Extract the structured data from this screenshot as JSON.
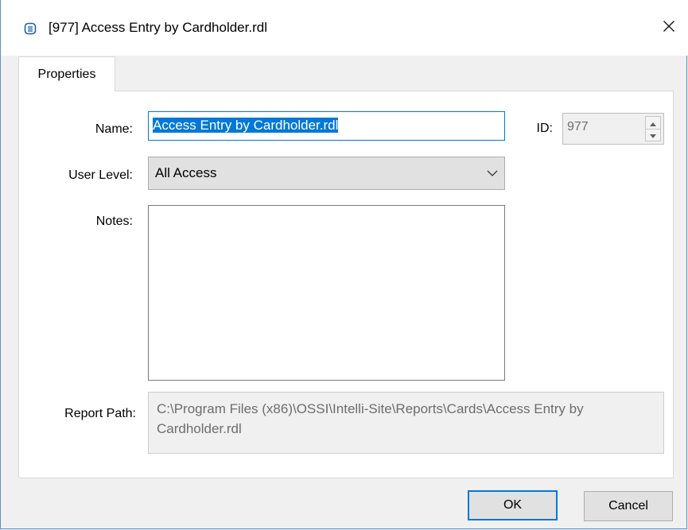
{
  "window": {
    "title": "[977] Access Entry by Cardholder.rdl",
    "close_glyph": "✕"
  },
  "tabs": [
    {
      "label": "Properties"
    }
  ],
  "form": {
    "name_label": "Name:",
    "name_value": "Access Entry by Cardholder.rdl",
    "id_label": "ID:",
    "id_value": "977",
    "user_level_label": "User Level:",
    "user_level_value": "All Access",
    "notes_label": "Notes:",
    "notes_value": "",
    "report_path_label": "Report Path:",
    "report_path_value": "C:\\Program Files (x86)\\OSSI\\Intelli-Site\\Reports\\Cards\\Access Entry by Cardholder.rdl"
  },
  "buttons": {
    "ok": "OK",
    "cancel": "Cancel"
  },
  "colors": {
    "accent": "#0078d7",
    "window_border": "#5a8fc9"
  }
}
